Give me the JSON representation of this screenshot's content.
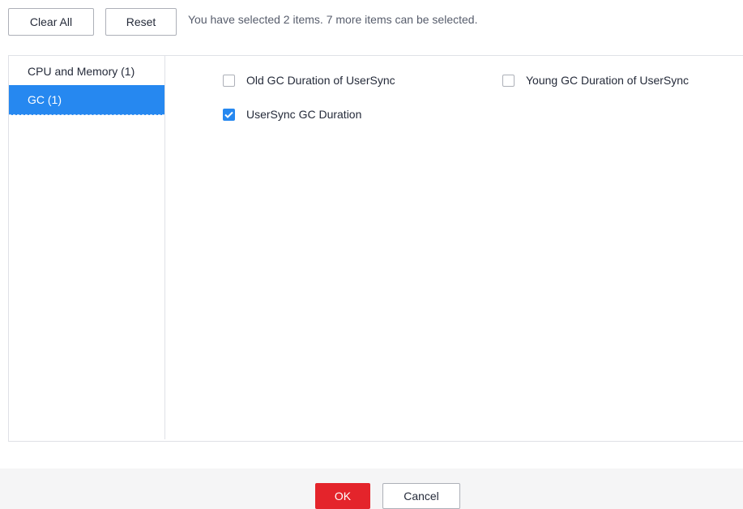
{
  "toolbar": {
    "clear_all_label": "Clear All",
    "reset_label": "Reset",
    "selection_hint": "You have selected 2 items. 7 more items can be selected."
  },
  "categories": [
    {
      "label": "CPU and Memory (1)",
      "active": false
    },
    {
      "label": "GC (1)",
      "active": true
    }
  ],
  "options": [
    {
      "label": "Old GC Duration of UserSync",
      "checked": false
    },
    {
      "label": "Young GC Duration of UserSync",
      "checked": false
    },
    {
      "label": "UserSync GC Duration",
      "checked": true
    }
  ],
  "footer": {
    "ok_label": "OK",
    "cancel_label": "Cancel"
  },
  "colors": {
    "accent": "#2688f0",
    "primary_button": "#e4242b",
    "border": "#dfe1e6",
    "footer_bg": "#f5f5f6"
  }
}
